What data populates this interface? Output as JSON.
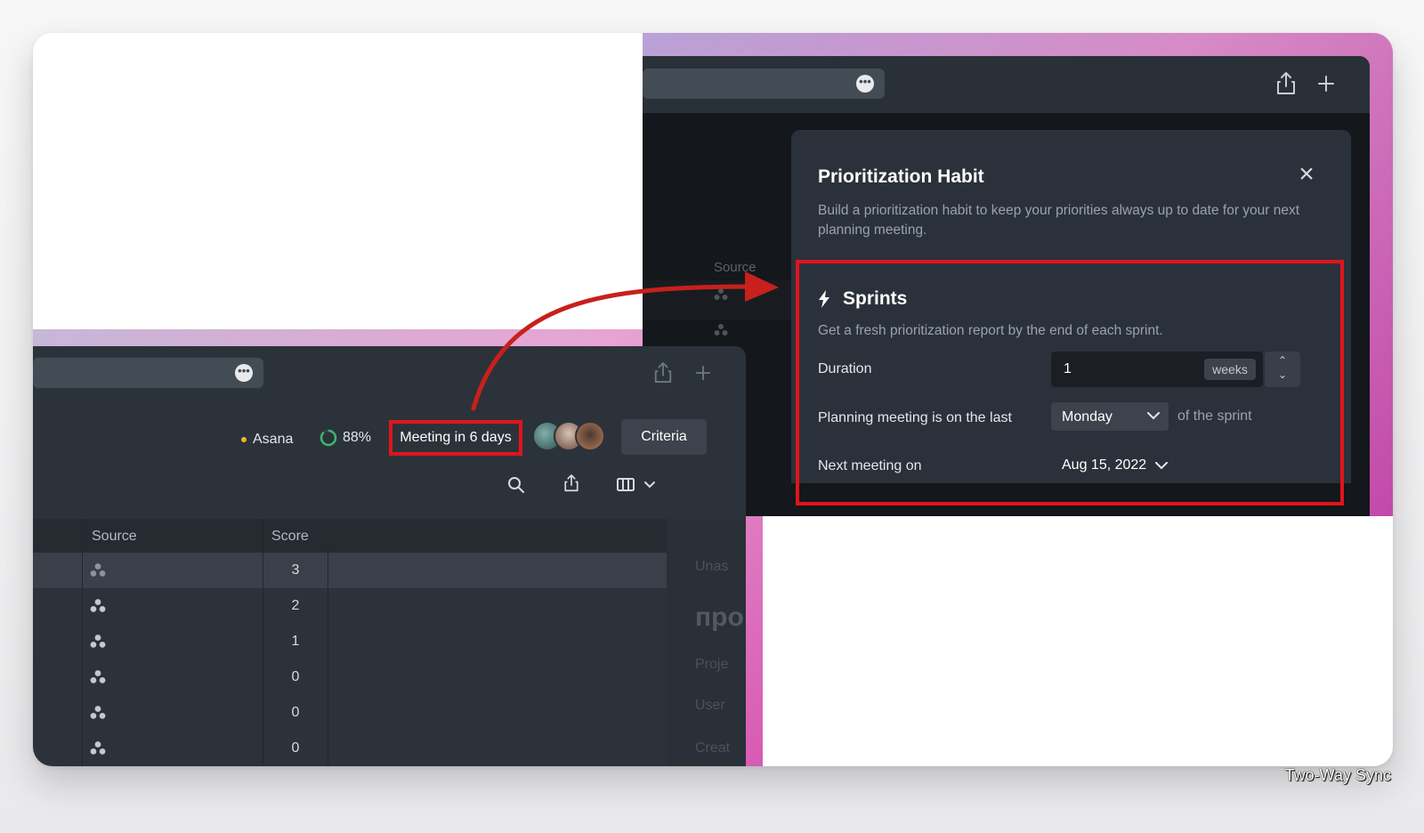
{
  "right_window": {
    "source_col": "Source",
    "toolbar_icons": [
      "more-icon",
      "share-icon",
      "plus-icon"
    ]
  },
  "dialog": {
    "title": "Prioritization Habit",
    "description": "Build a prioritization habit to keep your priorities always up to date for your next planning meeting.",
    "close_icon": "close-icon",
    "sprints": {
      "title": "Sprints",
      "icon": "lightning-icon",
      "description": "Get a fresh prioritization report by the end of each sprint.",
      "duration_label": "Duration",
      "duration_value": "1",
      "duration_unit": "weeks",
      "planning_label": "Planning meeting is on the last",
      "planning_day": "Monday",
      "planning_suffix": "of the sprint",
      "next_meeting_label": "Next meeting on",
      "next_meeting_date": "Aug 15, 2022"
    }
  },
  "left_window": {
    "integration": "Asana",
    "progress": "88%",
    "progress_value": 0.88,
    "meeting": "Meeting in 6 days",
    "criteria_button": "Criteria",
    "table": {
      "headers": [
        "Source",
        "Score"
      ],
      "rows": [
        {
          "score": "3"
        },
        {
          "score": "2"
        },
        {
          "score": "1"
        },
        {
          "score": "0"
        },
        {
          "score": "0"
        },
        {
          "score": "0"
        }
      ]
    },
    "ghost": {
      "unassigned": "Unas",
      "big": "про",
      "project": "Proje",
      "user": "User",
      "created": "Creat"
    }
  },
  "caption": "Two-Way Sync",
  "colors": {
    "highlight": "#e1141c",
    "arrow": "#c8201c",
    "dialog_bg": "#2b313a",
    "asana_dot": "#f0b429",
    "progress": "#3bb86b"
  }
}
